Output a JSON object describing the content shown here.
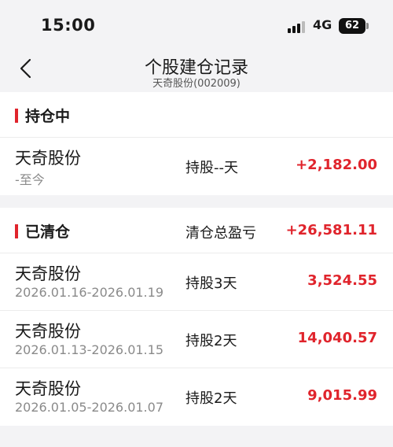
{
  "status_bar": {
    "time": "15:00",
    "network": "4G",
    "battery": "62",
    "signal_icon": "signal-bars-icon"
  },
  "nav": {
    "title": "个股建仓记录",
    "subtitle": "天奇股份(002009)",
    "back_icon": "chevron-left-icon"
  },
  "holding": {
    "title": "持仓中",
    "rows": [
      {
        "name": "天奇股份",
        "period": "-至今",
        "held": "持股--天",
        "pnl": "+2,182.00"
      }
    ]
  },
  "cleared": {
    "title": "已清仓",
    "summary_label": "清仓总盈亏",
    "summary_value": "+26,581.11",
    "rows": [
      {
        "name": "天奇股份",
        "period": "2026.01.16-2026.01.19",
        "held": "持股3天",
        "pnl": "3,524.55"
      },
      {
        "name": "天奇股份",
        "period": "2026.01.13-2026.01.15",
        "held": "持股2天",
        "pnl": "14,040.57"
      },
      {
        "name": "天奇股份",
        "period": "2026.01.05-2026.01.07",
        "held": "持股2天",
        "pnl": "9,015.99"
      }
    ]
  },
  "colors": {
    "accent_red": "#e0242c",
    "background": "#f3f3f5",
    "card": "#ffffff"
  }
}
